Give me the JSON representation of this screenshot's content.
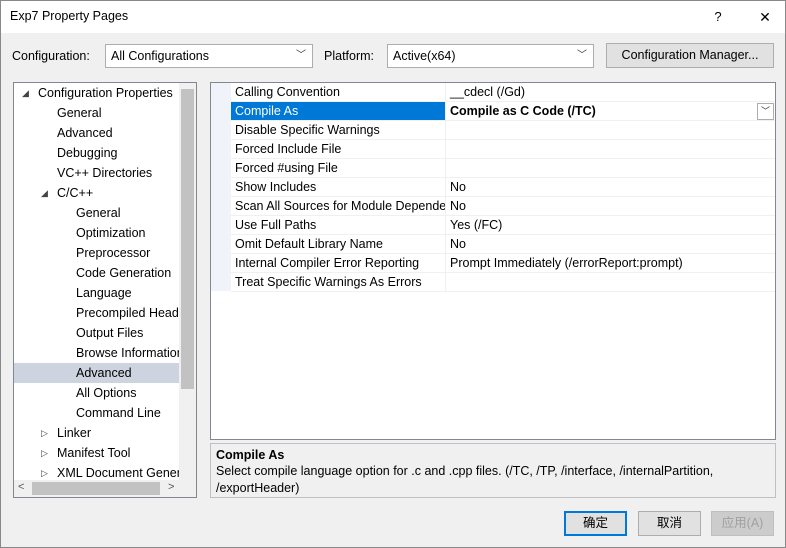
{
  "window": {
    "title": "Exp7 Property Pages",
    "help_glyph": "?",
    "close_glyph": "✕"
  },
  "toolbar": {
    "configuration_label": "Configuration:",
    "configuration_value": "All Configurations",
    "platform_label": "Platform:",
    "platform_value": "Active(x64)",
    "config_manager_label": "Configuration Manager..."
  },
  "tree": {
    "items": [
      {
        "label": "Configuration Properties",
        "expander": "◢"
      },
      {
        "label": "General"
      },
      {
        "label": "Advanced"
      },
      {
        "label": "Debugging"
      },
      {
        "label": "VC++ Directories"
      },
      {
        "label": "C/C++",
        "expander": "◢"
      },
      {
        "label": "General"
      },
      {
        "label": "Optimization"
      },
      {
        "label": "Preprocessor"
      },
      {
        "label": "Code Generation"
      },
      {
        "label": "Language"
      },
      {
        "label": "Precompiled Headers"
      },
      {
        "label": "Output Files"
      },
      {
        "label": "Browse Information"
      },
      {
        "label": "Advanced",
        "selected": true
      },
      {
        "label": "All Options"
      },
      {
        "label": "Command Line"
      },
      {
        "label": "Linker",
        "expander": "▷"
      },
      {
        "label": "Manifest Tool",
        "expander": "▷"
      },
      {
        "label": "XML Document Generator",
        "expander": "▷"
      }
    ],
    "scroll_left_glyph": "<",
    "scroll_right_glyph": ">"
  },
  "grid": {
    "rows": [
      {
        "name": "Calling Convention",
        "value": "__cdecl (/Gd)"
      },
      {
        "name": "Compile As",
        "value": "Compile as C Code (/TC)",
        "selected": true
      },
      {
        "name": "Disable Specific Warnings",
        "value": ""
      },
      {
        "name": "Forced Include File",
        "value": ""
      },
      {
        "name": "Forced #using File",
        "value": ""
      },
      {
        "name": "Show Includes",
        "value": "No"
      },
      {
        "name": "Scan All Sources for Module Dependencies",
        "value": "No"
      },
      {
        "name": "Use Full Paths",
        "value": "Yes (/FC)"
      },
      {
        "name": "Omit Default Library Name",
        "value": "No"
      },
      {
        "name": "Internal Compiler Error Reporting",
        "value": "Prompt Immediately (/errorReport:prompt)"
      },
      {
        "name": "Treat Specific Warnings As Errors",
        "value": ""
      }
    ],
    "dropdown_glyph": "﹀"
  },
  "description": {
    "title": "Compile As",
    "text_line1": "Select compile language option for .c and .cpp files.     (/TC, /TP, /interface, /internalPartition,",
    "text_line2": "/exportHeader)"
  },
  "buttons": {
    "ok": "确定",
    "cancel": "取消",
    "apply": "应用(A)"
  }
}
